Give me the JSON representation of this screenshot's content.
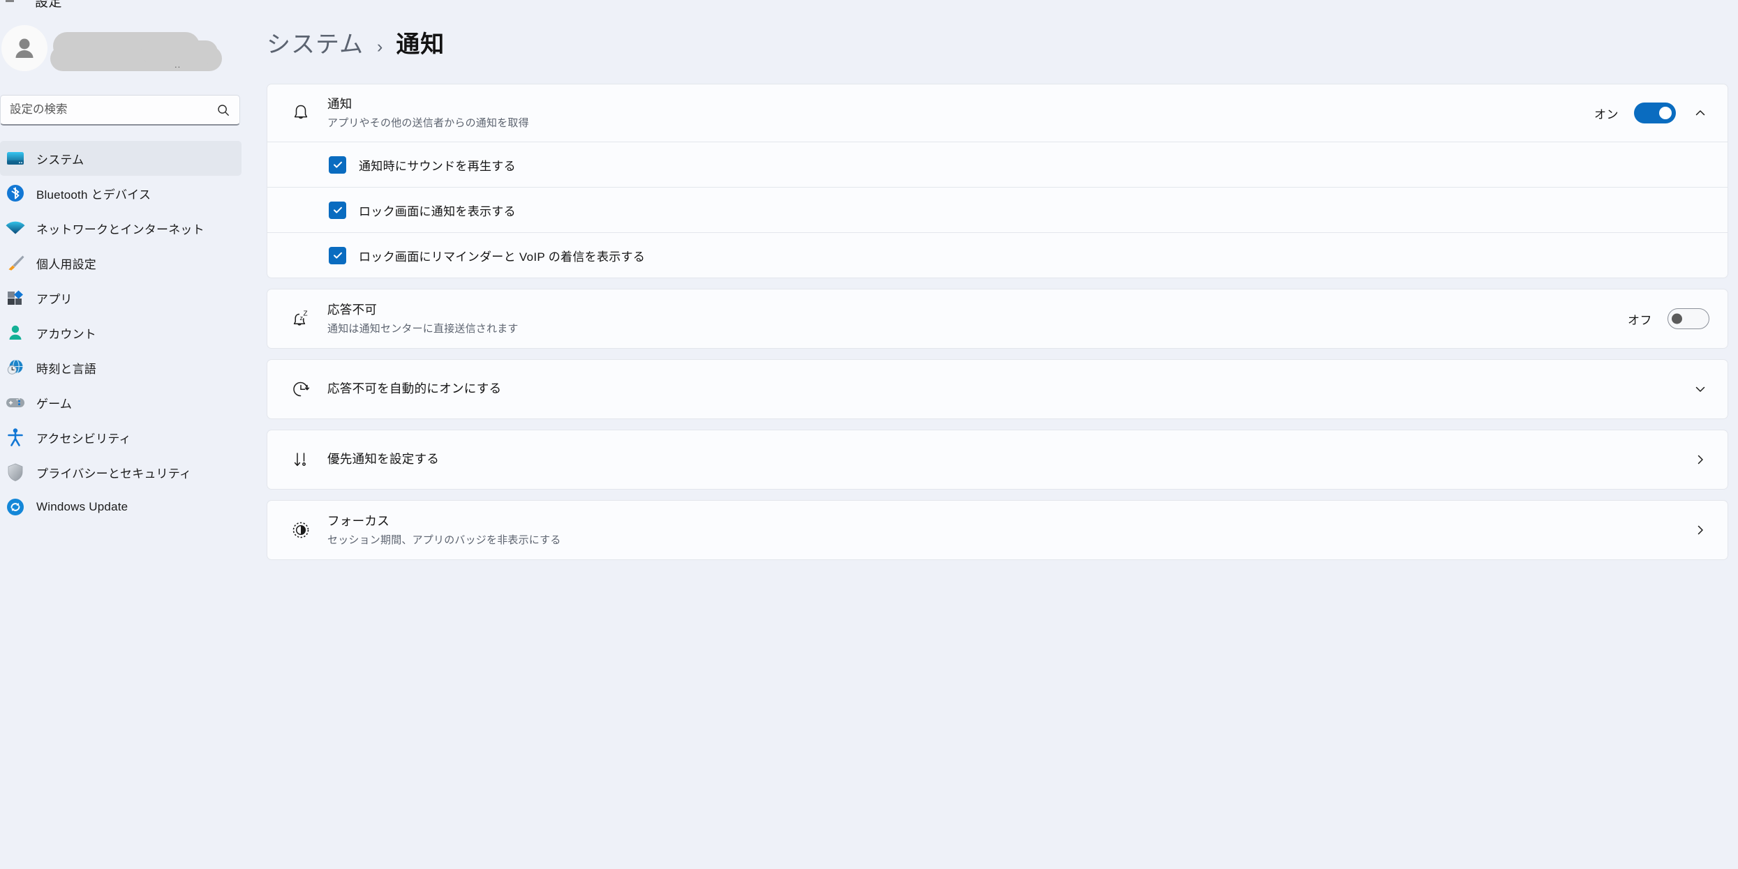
{
  "window": {
    "stub_title": "設定"
  },
  "sidebar": {
    "account": {
      "name_redacted": true,
      "dots": ".."
    },
    "search": {
      "placeholder": "設定の検索",
      "value": "",
      "icon": "search-icon"
    },
    "items": [
      {
        "id": "system",
        "label": "システム",
        "icon": "monitor-icon",
        "selected": true
      },
      {
        "id": "bluetooth",
        "label": "Bluetooth とデバイス",
        "icon": "bluetooth-icon",
        "selected": false
      },
      {
        "id": "network",
        "label": "ネットワークとインターネット",
        "icon": "wifi-icon",
        "selected": false
      },
      {
        "id": "personal",
        "label": "個人用設定",
        "icon": "paintbrush-icon",
        "selected": false
      },
      {
        "id": "apps",
        "label": "アプリ",
        "icon": "apps-icon",
        "selected": false
      },
      {
        "id": "accounts",
        "label": "アカウント",
        "icon": "person-icon",
        "selected": false
      },
      {
        "id": "time",
        "label": "時刻と言語",
        "icon": "globe-clock-icon",
        "selected": false
      },
      {
        "id": "gaming",
        "label": "ゲーム",
        "icon": "gamepad-icon",
        "selected": false
      },
      {
        "id": "access",
        "label": "アクセシビリティ",
        "icon": "accessibility-icon",
        "selected": false
      },
      {
        "id": "privacy",
        "label": "プライバシーとセキュリティ",
        "icon": "shield-icon",
        "selected": false
      },
      {
        "id": "update",
        "label": "Windows Update",
        "icon": "update-icon",
        "selected": false
      }
    ]
  },
  "breadcrumb": {
    "parent": "システム",
    "separator": "›",
    "current": "通知"
  },
  "main": {
    "notifications": {
      "icon": "bell-icon",
      "title": "通知",
      "subtitle": "アプリやその他の送信者からの通知を取得",
      "state_label": "オン",
      "toggle_on": true,
      "expand_icon": "chevron-up-icon",
      "options": [
        {
          "label": "通知時にサウンドを再生する",
          "checked": true
        },
        {
          "label": "ロック画面に通知を表示する",
          "checked": true
        },
        {
          "label": "ロック画面にリマインダーと VoIP の着信を表示する",
          "checked": true
        }
      ]
    },
    "do_not_disturb": {
      "icon": "bell-sleep-icon",
      "title": "応答不可",
      "subtitle": "通知は通知センターに直接送信されます",
      "state_label": "オフ",
      "toggle_on": false
    },
    "auto_dnd": {
      "icon": "clock-arrow-icon",
      "title": "応答不可を自動的にオンにする",
      "subtitle": "",
      "expand_icon": "chevron-down-icon"
    },
    "priority_notifications": {
      "icon": "priority-icon",
      "title": "優先通知を設定する",
      "subtitle": "",
      "expand_icon": "chevron-right-icon"
    },
    "focus": {
      "icon": "focus-icon",
      "title": "フォーカス",
      "subtitle": "セッション期間、アプリのバッジを非表示にする",
      "expand_icon": "chevron-right-icon"
    }
  },
  "colors": {
    "accent": "#0a6cc0",
    "page_bg": "#eef1f8",
    "card_bg": "#fbfcfe",
    "card_border": "#e3e6ec",
    "text": "#141414",
    "subtext": "#5d6470"
  }
}
